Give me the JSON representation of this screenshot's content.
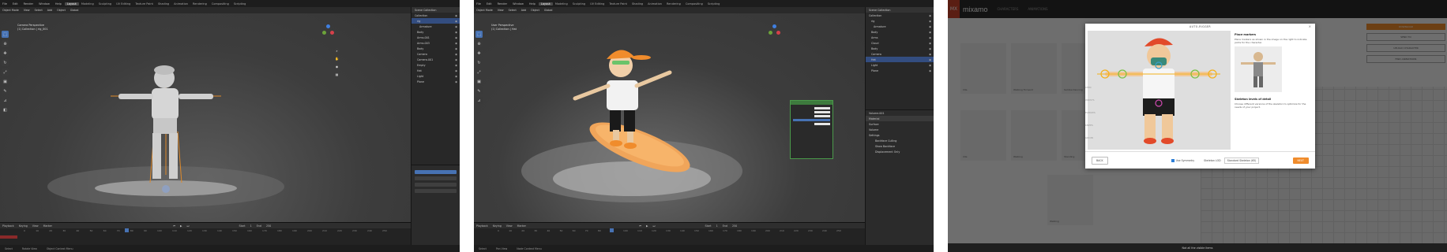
{
  "blender1": {
    "menu": [
      "File",
      "Edit",
      "Render",
      "Window",
      "Help"
    ],
    "workspaces": [
      "Layout",
      "Modeling",
      "Sculpting",
      "UV Editing",
      "Texture Paint",
      "Shading",
      "Animation",
      "Rendering",
      "Compositing",
      "Scripting"
    ],
    "active_workspace": "Layout",
    "header": [
      "Object Mode",
      "View",
      "Select",
      "Add",
      "Object",
      "Global"
    ],
    "viewport_text": [
      "Camera Perspective",
      "(1) Collection | rig_001"
    ],
    "outliner": [
      "Scene Collection",
      "Collection",
      "rig",
      "Armature",
      "Body",
      "Arms.001",
      "Arms.003",
      "Body",
      "Camera",
      "Camera.001",
      "Empty",
      "Hat",
      "Light",
      "Plane"
    ],
    "timeline_menu": [
      "Playback",
      "Keying",
      "View",
      "Marker"
    ],
    "ruler": [
      "0",
      "10",
      "20",
      "30",
      "40",
      "50",
      "60",
      "70",
      "80",
      "90",
      "100",
      "110",
      "120",
      "130",
      "140",
      "150",
      "160",
      "170",
      "180",
      "190",
      "200",
      "210",
      "220",
      "230",
      "240",
      "250"
    ],
    "start_label": "Start",
    "start": "1",
    "end_label": "End",
    "end": "250",
    "status": [
      "Select",
      "Rotate View",
      "Object Context Menu"
    ]
  },
  "blender2": {
    "menu": [
      "File",
      "Edit",
      "Render",
      "Window",
      "Help"
    ],
    "workspaces": [
      "Layout",
      "Modeling",
      "Sculpting",
      "UV Editing",
      "Texture Paint",
      "Shading",
      "Animation",
      "Rendering",
      "Compositing",
      "Scripting"
    ],
    "active_workspace": "Layout",
    "header": [
      "Object Mode",
      "View",
      "Select",
      "Add",
      "Object",
      "Global"
    ],
    "viewport_text": [
      "User Perspective",
      "(1) Collection | Hat"
    ],
    "outliner": [
      "Scene Collection",
      "Collection",
      "rig",
      "Armature",
      "Body",
      "Arms",
      "Cloud",
      "Body",
      "Camera",
      "Hat",
      "Light",
      "Plane"
    ],
    "properties": [
      "Volume.001",
      "Material",
      "Surface",
      "Volume",
      "Settings",
      "Backface Culling",
      "Show Backface",
      "Displacement Only"
    ],
    "timeline_menu": [
      "Playback",
      "Keying",
      "View",
      "Marker"
    ],
    "ruler": [
      "0",
      "10",
      "20",
      "30",
      "40",
      "50",
      "60",
      "70",
      "80",
      "90",
      "100",
      "110",
      "120",
      "130",
      "140",
      "150",
      "160",
      "170",
      "180",
      "190",
      "200",
      "210",
      "220",
      "230",
      "240",
      "250"
    ],
    "start_label": "Start",
    "start": "1",
    "end_label": "End",
    "end": "250",
    "status": [
      "Select",
      "Pan View",
      "Node Context Menu"
    ]
  },
  "mixamo": {
    "logo": "MX",
    "brand": "mixamo",
    "nav": [
      "CHARACTERS",
      "ANIMATIONS"
    ],
    "dialog_title": "AUTO-RIGGER",
    "close": "×",
    "markers": [
      "CHIN",
      "WRISTS",
      "ELBOWS",
      "KNEES",
      "GROIN"
    ],
    "side_title": "Place markers",
    "side_text": "Place markers as shown in the image on the right to indicate joints for the character.",
    "lod_title": "Skeleton levels of detail",
    "lod_text": "Choose different versions of the skeleton to optimize for the needs of your project.",
    "footer_back": "BACK",
    "footer_symmetry": "Use Symmetry",
    "footer_lod": "Skeleton LOD",
    "footer_lod_value": "Standard Skeleton (65)",
    "footer_next": "NEXT",
    "thumb_captions": [
      "Idle",
      "Walking Forward",
      "Samba Dancing",
      "Idle",
      "Walking",
      "Standing",
      "Walking"
    ],
    "right_panel": [
      "DOWNLOAD",
      "SEND TO",
      "UPLOAD CHARACTER",
      "FIND ANIMATIONS"
    ],
    "footer_note": "Not all the visible items"
  },
  "colors": {
    "blender_bg": "#3d3d3d",
    "outliner_sel": "#334d80",
    "mixamo_orange": "#f08c2c",
    "mixamo_red": "#c8432b"
  }
}
